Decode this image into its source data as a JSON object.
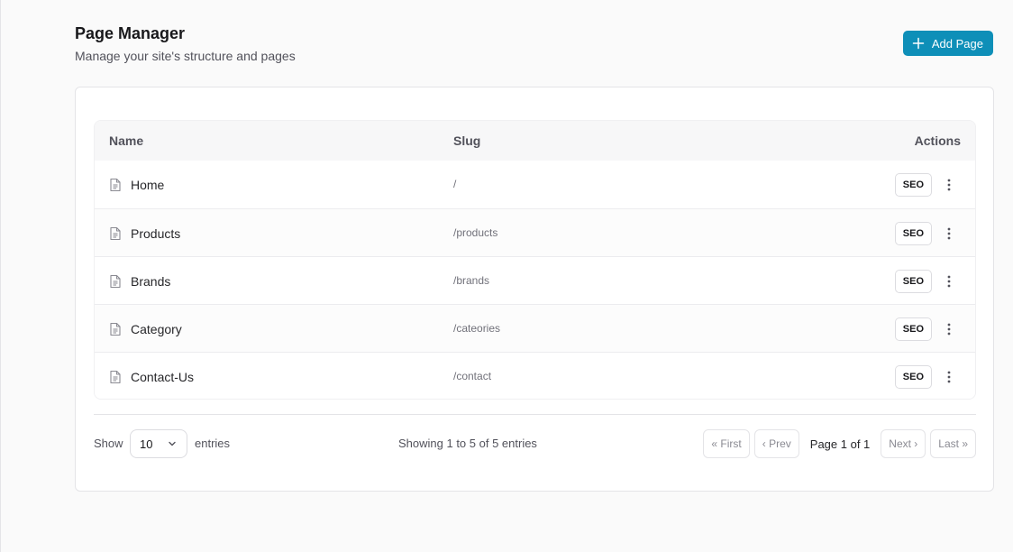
{
  "header": {
    "title": "Page Manager",
    "subtitle": "Manage your site's structure and pages",
    "add_button_label": "Add Page"
  },
  "table": {
    "columns": {
      "name": "Name",
      "slug": "Slug",
      "actions": "Actions"
    },
    "rows": [
      {
        "name": "Home",
        "slug": "/",
        "seo_label": "SEO"
      },
      {
        "name": "Products",
        "slug": "/products",
        "seo_label": "SEO"
      },
      {
        "name": "Brands",
        "slug": "/brands",
        "seo_label": "SEO"
      },
      {
        "name": "Category",
        "slug": "/cateories",
        "seo_label": "SEO"
      },
      {
        "name": "Contact-Us",
        "slug": "/contact",
        "seo_label": "SEO"
      }
    ]
  },
  "footer": {
    "show_label": "Show",
    "page_size": "10",
    "entries_label": "entries",
    "showing_text": "Showing 1 to 5 of 5 entries",
    "pager": {
      "first": "« First",
      "prev": "‹ Prev",
      "page_label": "Page 1 of 1",
      "next": "Next ›",
      "last": "Last »"
    }
  },
  "colors": {
    "accent": "#0e8fb8",
    "background": "#fafafa",
    "card": "#ffffff",
    "border": "#e4e4e7"
  },
  "icons": {
    "add": "plus-icon",
    "row": "document-icon",
    "row_menu": "more-vertical-icon",
    "select": "chevron-down-icon"
  }
}
